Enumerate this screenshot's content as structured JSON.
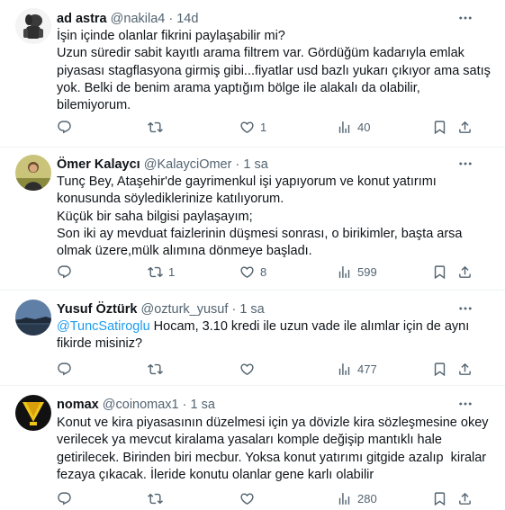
{
  "tweets": [
    {
      "name": "ad astra",
      "handle": "@nakila4",
      "dot": "·",
      "time": "14d",
      "body_lines": [
        "İşin içinde olanlar fikrini paylaşabilir mi?",
        "Uzun süredir sabit kayıtlı arama filtrem var. Gördüğüm kadarıyla emlak",
        "piyasası stagflasyona girmiş gibi...fiyatlar usd bazlı yukarı çıkıyor ama satış",
        "yok. Belki de benim arama yaptığım bölge ile alakalı da olabilir,",
        "bilemiyorum."
      ],
      "retweets": "",
      "likes": "1",
      "views": "40"
    },
    {
      "name": "Ömer Kalaycı",
      "handle": "@KalayciOmer",
      "dot": "·",
      "time": "1 sa",
      "body_lines": [
        "Tunç Bey, Ataşehir'de gayrimenkul işi yapıyorum ve konut yatırımı",
        "konusunda söylediklerinize katılıyorum.",
        "Küçük bir saha bilgisi paylaşayım;",
        "Son iki ay mevduat faizlerinin düşmesi sonrası, o birikimler, başta arsa",
        "olmak üzere,mülk alımına dönmeye başladı."
      ],
      "retweets": "1",
      "likes": "8",
      "views": "599"
    },
    {
      "name": "Yusuf Öztürk",
      "handle": "@ozturk_yusuf",
      "dot": "·",
      "time": "1 sa",
      "mention": "@TuncSatiroglu",
      "body_first_rest": " Hocam, 3.10 kredi ile uzun vade ile alımlar için de aynı",
      "body_lines": [
        "fikirde misiniz?"
      ],
      "retweets": "",
      "likes": "",
      "views": "477"
    },
    {
      "name": "nomax",
      "handle": "@coinomax1",
      "dot": "·",
      "time": "1 sa",
      "body_lines": [
        "Konut ve kira piyasasının düzelmesi için ya dövizle kira sözleşmesine okey",
        "verilecek ya mevcut kiralama yasaları komple değişip mantıklı hale",
        "getirilecek. Birinden biri mecbur. Yoksa konut yatırımı gitgide azalıp  kiralar",
        "fezaya çıkacak. İleride konutu olanlar gene karlı olabilir"
      ],
      "retweets": "",
      "likes": "",
      "views": "280"
    }
  ],
  "icons": {
    "reply": "reply-icon",
    "retweet": "retweet-icon",
    "like": "like-icon",
    "views": "views-icon",
    "bookmark": "bookmark-icon",
    "share": "share-icon",
    "more": "more-icon"
  },
  "colors": {
    "text": "#0f1419",
    "secondary": "#536471",
    "link": "#1d9bf0",
    "divider": "#eff3f4"
  }
}
